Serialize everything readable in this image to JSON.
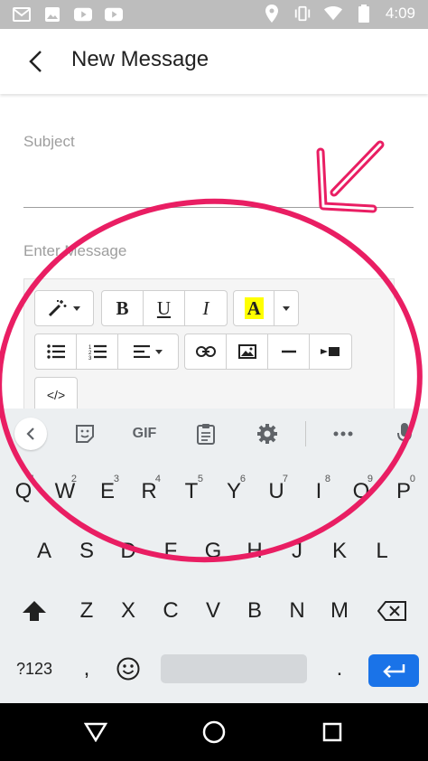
{
  "status_bar": {
    "time": "4:09",
    "left_icons": [
      "gmail-icon",
      "photos-icon",
      "youtube-icon",
      "youtube-icon"
    ],
    "right_icons": [
      "location-icon",
      "vibrate-icon",
      "wifi-icon",
      "battery-icon"
    ]
  },
  "app_bar": {
    "title": "New Message",
    "back_icon": "back-arrow-icon"
  },
  "form": {
    "subject_placeholder": "Subject",
    "message_placeholder": "Enter Message"
  },
  "editor_toolbar": {
    "row1": [
      "magic-wand-icon",
      "bold-icon",
      "underline-icon",
      "italic-icon",
      "highlight-color-icon"
    ],
    "row2": [
      "bullet-list-icon",
      "numbered-list-icon",
      "align-icon",
      "link-icon",
      "image-icon",
      "horizontal-rule-icon",
      "video-icon"
    ],
    "row3": [
      "code-view-icon"
    ],
    "bold_label": "B",
    "underline_label": "U",
    "italic_label": "I",
    "highlight_label": "A",
    "code_label": "</>",
    "highlight_color": "#ffff00"
  },
  "keyboard": {
    "toolbar": {
      "gif_label": "GIF",
      "icons": [
        "chevron-left-icon",
        "sticker-icon",
        "gif-icon",
        "clipboard-icon",
        "settings-icon",
        "more-icon",
        "mic-icon"
      ]
    },
    "row1": [
      {
        "label": "Q",
        "hint": "1"
      },
      {
        "label": "W",
        "hint": "2"
      },
      {
        "label": "E",
        "hint": "3"
      },
      {
        "label": "R",
        "hint": "4"
      },
      {
        "label": "T",
        "hint": "5"
      },
      {
        "label": "Y",
        "hint": "6"
      },
      {
        "label": "U",
        "hint": "7"
      },
      {
        "label": "I",
        "hint": "8"
      },
      {
        "label": "O",
        "hint": "9"
      },
      {
        "label": "P",
        "hint": "0"
      }
    ],
    "row2": [
      "A",
      "S",
      "D",
      "F",
      "G",
      "H",
      "J",
      "K",
      "L"
    ],
    "row3": [
      "Z",
      "X",
      "C",
      "V",
      "B",
      "N",
      "M"
    ],
    "symbols_label": "?123",
    "comma_label": ",",
    "period_label": "."
  },
  "annotation": {
    "color": "#e91e63"
  },
  "colors": {
    "enter_key": "#1a73e8",
    "status_bar": "#bdbdbd",
    "nav_bar": "#000000"
  }
}
